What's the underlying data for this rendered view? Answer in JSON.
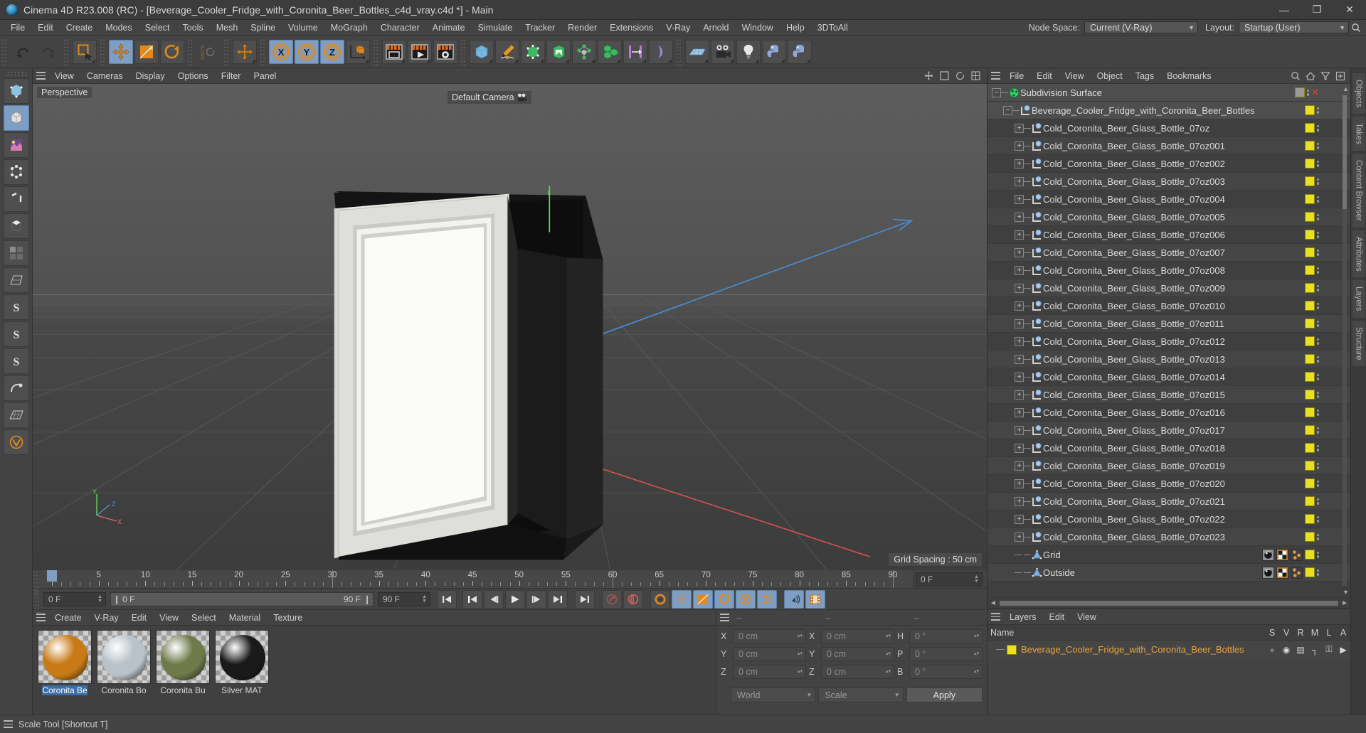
{
  "titlebar": {
    "title": "Cinema 4D R23.008 (RC) - [Beverage_Cooler_Fridge_with_Coronita_Beer_Bottles_c4d_vray.c4d *] - Main",
    "minimize": "—",
    "maximize": "❐",
    "close": "✕"
  },
  "menubar": {
    "items": [
      "File",
      "Edit",
      "Create",
      "Modes",
      "Select",
      "Tools",
      "Mesh",
      "Spline",
      "Volume",
      "MoGraph",
      "Character",
      "Animate",
      "Simulate",
      "Tracker",
      "Render",
      "Extensions",
      "V-Ray",
      "Arnold",
      "Window",
      "Help",
      "3DToAll"
    ],
    "node_space_label": "Node Space:",
    "node_space_value": "Current (V-Ray)",
    "layout_label": "Layout:",
    "layout_value": "Startup (User)",
    "search_icon": "search-icon"
  },
  "toolbar": {
    "groups": [
      {
        "name": "history",
        "buttons": [
          {
            "icon": "undo-icon",
            "label": "Undo",
            "selected": false
          },
          {
            "icon": "redo-icon",
            "label": "Redo",
            "selected": false
          }
        ]
      },
      {
        "name": "select",
        "buttons": [
          {
            "icon": "live-selection-icon",
            "label": "Live Selection",
            "selected": false
          }
        ]
      },
      {
        "name": "transform",
        "buttons": [
          {
            "icon": "move-icon",
            "label": "Move",
            "selected": true
          },
          {
            "icon": "scale-icon",
            "label": "Scale",
            "selected": false
          },
          {
            "icon": "rotate-icon",
            "label": "Rotate",
            "selected": false
          }
        ]
      },
      {
        "name": "psr",
        "buttons": [
          {
            "icon": "psr-icon",
            "label": "PSR",
            "selected": false
          }
        ]
      },
      {
        "name": "world-axis",
        "buttons": [
          {
            "icon": "world-move-icon",
            "label": "World/Object",
            "selected": false
          }
        ]
      },
      {
        "name": "axis-lock",
        "buttons": [
          {
            "icon": "x-axis-icon",
            "label": "X",
            "selected": true
          },
          {
            "icon": "y-axis-icon",
            "label": "Y",
            "selected": true
          },
          {
            "icon": "z-axis-icon",
            "label": "Z",
            "selected": true
          },
          {
            "icon": "coordinate-system-icon",
            "label": "Coordinate System",
            "selected": false
          }
        ]
      },
      {
        "name": "render",
        "buttons": [
          {
            "icon": "render-view-icon",
            "label": "Render View",
            "selected": false
          },
          {
            "icon": "render-queue-icon",
            "label": "Render to Picture Viewer",
            "selected": false
          },
          {
            "icon": "render-settings-icon",
            "label": "Render Settings",
            "selected": false
          }
        ]
      },
      {
        "name": "primitives",
        "buttons": [
          {
            "icon": "cube-icon",
            "label": "Cube",
            "selected": false
          },
          {
            "icon": "pen-icon",
            "label": "Pen",
            "selected": false
          },
          {
            "icon": "hyper-nurbs-icon",
            "label": "Subdivision Surface",
            "selected": false
          },
          {
            "icon": "array-icon",
            "label": "Array",
            "selected": false
          },
          {
            "icon": "deformer-icon",
            "label": "Bend",
            "selected": false
          },
          {
            "icon": "cloner-icon",
            "label": "MoGraph Cloner",
            "selected": false
          },
          {
            "icon": "symmetry-icon",
            "label": "Symmetry",
            "selected": false
          },
          {
            "icon": "bend-deformer-icon",
            "label": "Deformer",
            "selected": false
          }
        ]
      },
      {
        "name": "scene",
        "buttons": [
          {
            "icon": "floor-icon",
            "label": "Floor",
            "selected": false
          },
          {
            "icon": "camera-icon",
            "label": "Camera",
            "selected": false
          },
          {
            "icon": "light-icon",
            "label": "Light",
            "selected": false
          },
          {
            "icon": "python-icon",
            "label": "Python",
            "selected": false
          },
          {
            "icon": "python-generator-icon",
            "label": "Python Generator",
            "selected": false
          }
        ]
      }
    ]
  },
  "left_palette": {
    "buttons": [
      {
        "icon": "make-editable-icon",
        "label": "Make Editable",
        "selected": false
      },
      {
        "icon": "model-mode-icon",
        "label": "Model Mode",
        "selected": true
      },
      {
        "icon": "texture-mode-icon",
        "label": "Texture Mode",
        "selected": false
      },
      {
        "icon": "points-mode-icon",
        "label": "Points Mode",
        "selected": false
      },
      {
        "icon": "edges-mode-icon",
        "label": "Edges Mode",
        "selected": false
      },
      {
        "icon": "polygons-mode-icon",
        "label": "Polygons Mode",
        "selected": false
      },
      {
        "icon": "viewport-solo-icon",
        "label": "Viewport Solo",
        "selected": false
      },
      {
        "icon": "workplane-icon",
        "label": "Workplane",
        "selected": false
      },
      {
        "icon": "snap-icon",
        "label": "Enable Snap",
        "selected": false
      },
      {
        "icon": "snap2-icon",
        "label": "Snap Settings",
        "selected": false
      },
      {
        "icon": "snap3-icon",
        "label": "Quantize",
        "selected": false
      },
      {
        "icon": "dynamics-icon",
        "label": "Dynamics",
        "selected": false
      },
      {
        "icon": "grid-snap-icon",
        "label": "Grid",
        "selected": false
      },
      {
        "icon": "vray-icon",
        "label": "V-Ray",
        "selected": false
      }
    ]
  },
  "viewport": {
    "menu": [
      "View",
      "Cameras",
      "Display",
      "Options",
      "Filter",
      "Panel"
    ],
    "view_label": "Perspective",
    "camera_label": "Default Camera",
    "grid_spacing": "Grid Spacing : 50 cm",
    "axis": {
      "x": "X",
      "y": "Y",
      "z": "Z"
    }
  },
  "timeline": {
    "ticks": [
      {
        "value": "0",
        "frame": 0
      },
      {
        "value": "5",
        "frame": 5
      },
      {
        "value": "10",
        "frame": 10
      },
      {
        "value": "15",
        "frame": 15
      },
      {
        "value": "20",
        "frame": 20
      },
      {
        "value": "25",
        "frame": 25
      },
      {
        "value": "30",
        "frame": 30
      },
      {
        "value": "35",
        "frame": 35
      },
      {
        "value": "40",
        "frame": 40
      },
      {
        "value": "45",
        "frame": 45
      },
      {
        "value": "50",
        "frame": 50
      },
      {
        "value": "55",
        "frame": 55
      },
      {
        "value": "60",
        "frame": 60
      },
      {
        "value": "65",
        "frame": 65
      },
      {
        "value": "70",
        "frame": 70
      },
      {
        "value": "75",
        "frame": 75
      },
      {
        "value": "80",
        "frame": 80
      },
      {
        "value": "85",
        "frame": 85
      },
      {
        "value": "90",
        "frame": 90
      }
    ],
    "current_frame_field": "0 F",
    "playhead_frame": 0
  },
  "animbar": {
    "current_frame": "0 F",
    "range_start": "0 F",
    "range_end": "90 F",
    "max_frame": "90 F",
    "buttons": [
      {
        "icon": "go-to-start-icon",
        "label": "Go to Start",
        "selected": false
      },
      {
        "icon": "go-to-previous-key-icon",
        "label": "Go to Previous Key",
        "selected": false
      },
      {
        "icon": "step-back-icon",
        "label": "Go to Previous Frame",
        "selected": false
      },
      {
        "icon": "play-icon",
        "label": "Play Forwards",
        "selected": false
      },
      {
        "icon": "step-forward-icon",
        "label": "Go to Next Frame",
        "selected": false
      },
      {
        "icon": "go-to-next-key-icon",
        "label": "Go to Next Key",
        "selected": false
      },
      {
        "icon": "go-to-end-icon",
        "label": "Go to End",
        "selected": false
      },
      {
        "icon": "record-key-icon",
        "label": "Record Active Objects",
        "selected": false
      },
      {
        "icon": "autokey-icon",
        "label": "Autokeying",
        "selected": false
      },
      {
        "icon": "keyframe-settings-icon",
        "label": "Keyframe Selection",
        "selected": false
      },
      {
        "icon": "position-key-icon",
        "label": "Position",
        "selected": true
      },
      {
        "icon": "scale-key-icon",
        "label": "Scale",
        "selected": true
      },
      {
        "icon": "rotation-key-icon",
        "label": "Rotation",
        "selected": true
      },
      {
        "icon": "param-key-icon",
        "label": "Parameter",
        "selected": true
      },
      {
        "icon": "point-level-anim-icon",
        "label": "Point Level Animation",
        "selected": true
      },
      {
        "icon": "sound-icon",
        "label": "Sound",
        "selected": true
      },
      {
        "icon": "filmstrip-icon",
        "label": "Timeline",
        "selected": true
      }
    ]
  },
  "materials": {
    "menu": [
      "Create",
      "V-Ray",
      "Edit",
      "View",
      "Select",
      "Material",
      "Texture"
    ],
    "items": [
      {
        "name": "Coronita Be",
        "selected": true,
        "color": "#c87a16",
        "icon": "material-sphere-icon"
      },
      {
        "name": "Coronita Bo",
        "selected": false,
        "color": "#b9c2c8",
        "icon": "material-sphere-icon"
      },
      {
        "name": "Coronita Bu",
        "selected": false,
        "color": "#6f7a4a",
        "icon": "material-sphere-icon"
      },
      {
        "name": "Silver MAT",
        "selected": false,
        "color": "#1a1a1a",
        "icon": "material-sphere-icon"
      }
    ]
  },
  "coordinates": {
    "header": [
      "--",
      "--",
      "--"
    ],
    "rows": [
      {
        "label": "X",
        "pos": "0 cm",
        "label2": "X",
        "size": "0 cm",
        "label3": "H",
        "rot": "0 °"
      },
      {
        "label": "Y",
        "pos": "0 cm",
        "label2": "Y",
        "size": "0 cm",
        "label3": "P",
        "rot": "0 °"
      },
      {
        "label": "Z",
        "pos": "0 cm",
        "label2": "Z",
        "size": "0 cm",
        "label3": "B",
        "rot": "0 °"
      }
    ],
    "coord_system": "World",
    "transform_mode": "Scale",
    "apply_label": "Apply"
  },
  "objects": {
    "menu": [
      "File",
      "Edit",
      "View",
      "Object",
      "Tags",
      "Bookmarks"
    ],
    "header_icons": [
      "search-icon",
      "home-icon",
      "filter-icon",
      "add-icon"
    ],
    "tree": [
      {
        "name": "Subdivision Surface",
        "depth": 0,
        "icon": "subdivision-surface-icon",
        "expander": "−",
        "tag_color": "#9a9a9a",
        "has_x": true,
        "selected": true
      },
      {
        "name": "Beverage_Cooler_Fridge_with_Coronita_Beer_Bottles",
        "depth": 1,
        "icon": "null-object-icon",
        "expander": "−",
        "tag_color": "#e8e020",
        "has_x": false,
        "selected": true
      },
      {
        "name": "Cold_Coronita_Beer_Glass_Bottle_07oz",
        "depth": 2,
        "icon": "null-object-icon",
        "expander": "+",
        "tag_color": "#e8e020",
        "has_x": false,
        "selected": false
      },
      {
        "name": "Cold_Coronita_Beer_Glass_Bottle_07oz001",
        "depth": 2,
        "icon": "null-object-icon",
        "expander": "+",
        "tag_color": "#e8e020",
        "has_x": false,
        "selected": false
      },
      {
        "name": "Cold_Coronita_Beer_Glass_Bottle_07oz002",
        "depth": 2,
        "icon": "null-object-icon",
        "expander": "+",
        "tag_color": "#e8e020",
        "has_x": false,
        "selected": false
      },
      {
        "name": "Cold_Coronita_Beer_Glass_Bottle_07oz003",
        "depth": 2,
        "icon": "null-object-icon",
        "expander": "+",
        "tag_color": "#e8e020",
        "has_x": false,
        "selected": false
      },
      {
        "name": "Cold_Coronita_Beer_Glass_Bottle_07oz004",
        "depth": 2,
        "icon": "null-object-icon",
        "expander": "+",
        "tag_color": "#e8e020",
        "has_x": false,
        "selected": false
      },
      {
        "name": "Cold_Coronita_Beer_Glass_Bottle_07oz005",
        "depth": 2,
        "icon": "null-object-icon",
        "expander": "+",
        "tag_color": "#e8e020",
        "has_x": false,
        "selected": false
      },
      {
        "name": "Cold_Coronita_Beer_Glass_Bottle_07oz006",
        "depth": 2,
        "icon": "null-object-icon",
        "expander": "+",
        "tag_color": "#e8e020",
        "has_x": false,
        "selected": false
      },
      {
        "name": "Cold_Coronita_Beer_Glass_Bottle_07oz007",
        "depth": 2,
        "icon": "null-object-icon",
        "expander": "+",
        "tag_color": "#e8e020",
        "has_x": false,
        "selected": false
      },
      {
        "name": "Cold_Coronita_Beer_Glass_Bottle_07oz008",
        "depth": 2,
        "icon": "null-object-icon",
        "expander": "+",
        "tag_color": "#e8e020",
        "has_x": false,
        "selected": false
      },
      {
        "name": "Cold_Coronita_Beer_Glass_Bottle_07oz009",
        "depth": 2,
        "icon": "null-object-icon",
        "expander": "+",
        "tag_color": "#e8e020",
        "has_x": false,
        "selected": false
      },
      {
        "name": "Cold_Coronita_Beer_Glass_Bottle_07oz010",
        "depth": 2,
        "icon": "null-object-icon",
        "expander": "+",
        "tag_color": "#e8e020",
        "has_x": false,
        "selected": false
      },
      {
        "name": "Cold_Coronita_Beer_Glass_Bottle_07oz011",
        "depth": 2,
        "icon": "null-object-icon",
        "expander": "+",
        "tag_color": "#e8e020",
        "has_x": false,
        "selected": false
      },
      {
        "name": "Cold_Coronita_Beer_Glass_Bottle_07oz012",
        "depth": 2,
        "icon": "null-object-icon",
        "expander": "+",
        "tag_color": "#e8e020",
        "has_x": false,
        "selected": false
      },
      {
        "name": "Cold_Coronita_Beer_Glass_Bottle_07oz013",
        "depth": 2,
        "icon": "null-object-icon",
        "expander": "+",
        "tag_color": "#e8e020",
        "has_x": false,
        "selected": false
      },
      {
        "name": "Cold_Coronita_Beer_Glass_Bottle_07oz014",
        "depth": 2,
        "icon": "null-object-icon",
        "expander": "+",
        "tag_color": "#e8e020",
        "has_x": false,
        "selected": false
      },
      {
        "name": "Cold_Coronita_Beer_Glass_Bottle_07oz015",
        "depth": 2,
        "icon": "null-object-icon",
        "expander": "+",
        "tag_color": "#e8e020",
        "has_x": false,
        "selected": false
      },
      {
        "name": "Cold_Coronita_Beer_Glass_Bottle_07oz016",
        "depth": 2,
        "icon": "null-object-icon",
        "expander": "+",
        "tag_color": "#e8e020",
        "has_x": false,
        "selected": false
      },
      {
        "name": "Cold_Coronita_Beer_Glass_Bottle_07oz017",
        "depth": 2,
        "icon": "null-object-icon",
        "expander": "+",
        "tag_color": "#e8e020",
        "has_x": false,
        "selected": false
      },
      {
        "name": "Cold_Coronita_Beer_Glass_Bottle_07oz018",
        "depth": 2,
        "icon": "null-object-icon",
        "expander": "+",
        "tag_color": "#e8e020",
        "has_x": false,
        "selected": false
      },
      {
        "name": "Cold_Coronita_Beer_Glass_Bottle_07oz019",
        "depth": 2,
        "icon": "null-object-icon",
        "expander": "+",
        "tag_color": "#e8e020",
        "has_x": false,
        "selected": false
      },
      {
        "name": "Cold_Coronita_Beer_Glass_Bottle_07oz020",
        "depth": 2,
        "icon": "null-object-icon",
        "expander": "+",
        "tag_color": "#e8e020",
        "has_x": false,
        "selected": false
      },
      {
        "name": "Cold_Coronita_Beer_Glass_Bottle_07oz021",
        "depth": 2,
        "icon": "null-object-icon",
        "expander": "+",
        "tag_color": "#e8e020",
        "has_x": false,
        "selected": false
      },
      {
        "name": "Cold_Coronita_Beer_Glass_Bottle_07oz022",
        "depth": 2,
        "icon": "null-object-icon",
        "expander": "+",
        "tag_color": "#e8e020",
        "has_x": false,
        "selected": false
      },
      {
        "name": "Cold_Coronita_Beer_Glass_Bottle_07oz023",
        "depth": 2,
        "icon": "null-object-icon",
        "expander": "+",
        "tag_color": "#e8e020",
        "has_x": false,
        "selected": false
      },
      {
        "name": "Grid",
        "depth": 2,
        "icon": "polygon-object-icon",
        "expander": "",
        "tag_color": "#e8e020",
        "has_x": false,
        "selected": false,
        "extra_tags": [
          "material-tag-icon",
          "uvw-tag-icon",
          "selection-tag-icon"
        ]
      },
      {
        "name": "Outside",
        "depth": 2,
        "icon": "polygon-object-icon",
        "expander": "",
        "tag_color": "#e8e020",
        "has_x": false,
        "selected": false,
        "extra_tags": [
          "material-tag-icon",
          "uvw-tag-icon",
          "selection-tag-icon"
        ]
      }
    ]
  },
  "layers": {
    "menu": [
      "Layers",
      "Edit",
      "View"
    ],
    "columns": [
      "Name",
      "S",
      "V",
      "R",
      "M",
      "L",
      "A"
    ],
    "rows": [
      {
        "name": "Beverage_Cooler_Fridge_with_Coronita_Beer_Bottles",
        "color": "#e8e020",
        "icons": [
          "solo-dot-icon",
          "eye-icon",
          "render-icon",
          "manager-icon",
          "lock-icon",
          "animation-icon"
        ]
      }
    ]
  },
  "right_tabs": [
    "Objects",
    "Takes",
    "Content Browser",
    "Attributes",
    "Layers",
    "Structure"
  ],
  "statusbar": {
    "message": "Scale Tool [Shortcut T]"
  }
}
